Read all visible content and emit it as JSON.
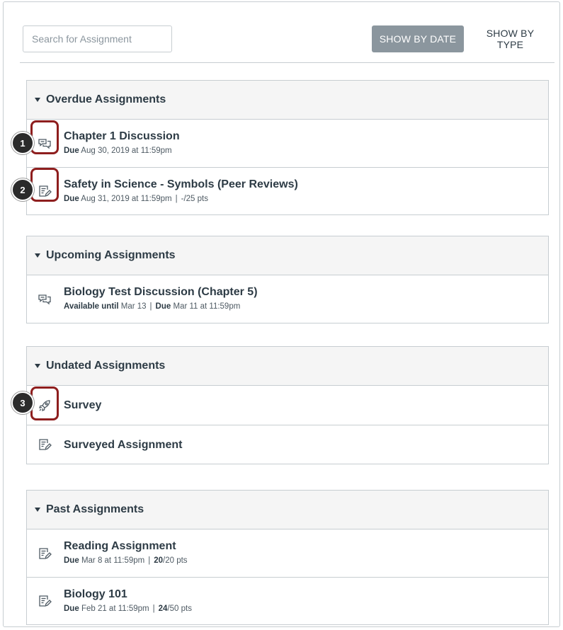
{
  "toolbar": {
    "search_placeholder": "Search for Assignment",
    "show_by_date": "SHOW BY DATE",
    "show_by_type": "SHOW BY TYPE"
  },
  "groups": [
    {
      "title": "Overdue Assignments",
      "items": [
        {
          "icon": "discussion-icon",
          "title": "Chapter 1 Discussion",
          "due_label": "Due",
          "due": "Aug 30, 2019 at 11:59pm"
        },
        {
          "icon": "assignment-icon",
          "title": "Safety in Science - Symbols (Peer Reviews)",
          "due_label": "Due",
          "due": "Aug 31, 2019 at 11:59pm",
          "sep": "|",
          "points": "-/25 pts"
        }
      ]
    },
    {
      "title": "Upcoming Assignments",
      "items": [
        {
          "icon": "discussion-icon",
          "title": "Biology Test Discussion (Chapter 5)",
          "avail_label": "Available until",
          "avail": "Mar 13",
          "sep": "|",
          "due_label": "Due",
          "due": "Mar 11 at 11:59pm"
        }
      ]
    },
    {
      "title": "Undated Assignments",
      "items": [
        {
          "icon": "quiz-rocket-icon",
          "title": "Survey"
        },
        {
          "icon": "assignment-icon",
          "title": "Surveyed Assignment"
        }
      ]
    },
    {
      "title": "Past Assignments",
      "items": [
        {
          "icon": "assignment-icon",
          "title": "Reading Assignment",
          "due_label": "Due",
          "due": "Mar 8 at 11:59pm",
          "sep": "|",
          "score": "20",
          "points": "/20 pts"
        },
        {
          "icon": "assignment-icon",
          "title": "Biology 101",
          "due_label": "Due",
          "due": "Feb 21 at 11:59pm",
          "sep": "|",
          "score": "24",
          "points": "/50 pts"
        }
      ]
    }
  ],
  "callouts": [
    "1",
    "2",
    "3"
  ],
  "colors": {
    "accent_button": "#8b969e",
    "callout_border": "#8e1e1e",
    "text": "#2d3b45"
  }
}
